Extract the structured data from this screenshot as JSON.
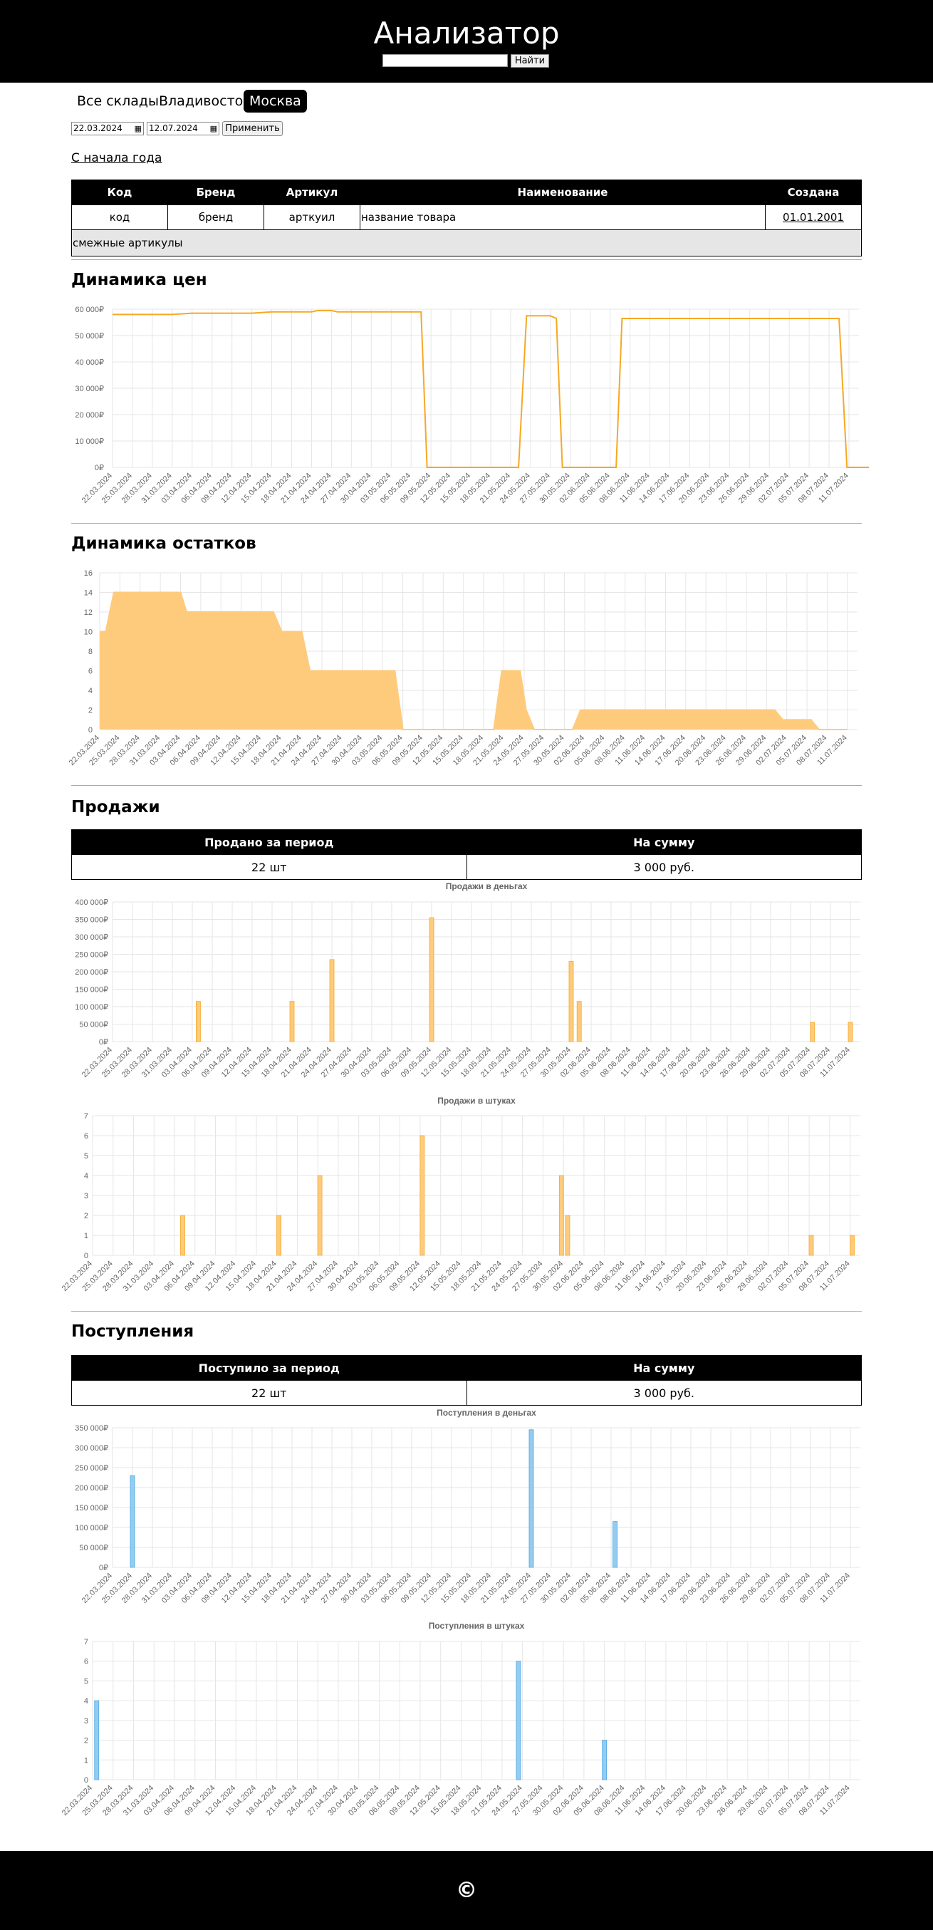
{
  "header": {
    "title": "Анализатор",
    "search_value": "",
    "search_button": "Найти"
  },
  "tabs": [
    "Все склады",
    "Владивосток",
    "Москва"
  ],
  "filters": {
    "date_from": "22.03.2024",
    "date_to": "12.07.2024",
    "apply_label": "Применить"
  },
  "since_link": "С начала года",
  "product": {
    "headers": [
      "Код",
      "Бренд",
      "Артикул",
      "Наименование",
      "Создана"
    ],
    "row": [
      "код",
      "бренд",
      "арткуил",
      "название товара",
      "01.01.2001"
    ],
    "related": "смежные артикулы"
  },
  "sections": {
    "prices": "Динамика цен",
    "stock": "Динамика остатков",
    "sales": "Продажи",
    "supplies": "Поступления"
  },
  "sales_summary": {
    "headers": [
      "Продано за период",
      "На сумму"
    ],
    "values": [
      "22 шт",
      "3 000 руб."
    ]
  },
  "supplies_summary": {
    "headers": [
      "Поступило за период",
      "На сумму"
    ],
    "values": [
      "22 шт",
      "3 000 руб."
    ]
  },
  "footer": {
    "copyright": "©"
  },
  "colors": {
    "orange_line": "#f7a823",
    "orange_fill": "#fecb7c",
    "blue_fill": "#94cbf0",
    "blue_line": "#4ba7e3"
  },
  "chart_data": [
    {
      "id": "price",
      "type": "line",
      "title": "",
      "x": [
        "22.03.2024",
        "25.03.2024",
        "28.03.2024",
        "31.03.2024",
        "03.04.2024",
        "06.04.2024",
        "09.04.2024",
        "12.04.2024",
        "15.04.2024",
        "18.04.2024",
        "21.04.2024",
        "24.04.2024",
        "27.04.2024",
        "30.04.2024",
        "03.05.2024",
        "06.05.2024",
        "09.05.2024",
        "12.05.2024",
        "15.05.2024",
        "18.05.2024",
        "21.05.2024",
        "24.05.2024",
        "27.05.2024",
        "30.05.2024",
        "02.06.2024",
        "05.06.2024",
        "08.06.2024",
        "11.06.2024",
        "14.06.2024",
        "17.06.2024",
        "20.06.2024",
        "23.06.2024",
        "26.06.2024",
        "29.06.2024",
        "02.07.2024",
        "05.07.2024",
        "08.07.2024",
        "11.07.2024"
      ],
      "yticks": [
        "0₽",
        "10 000₽",
        "20 000₽",
        "30 000₽",
        "40 000₽",
        "50 000₽",
        "60 000₽"
      ],
      "ylim": [
        0,
        60000
      ],
      "points": [
        [
          0,
          58000
        ],
        [
          3,
          58000
        ],
        [
          4,
          58500
        ],
        [
          7,
          58500
        ],
        [
          8,
          59000
        ],
        [
          10,
          59000
        ],
        [
          10.3,
          59500
        ],
        [
          11,
          59500
        ],
        [
          11.3,
          59000
        ],
        [
          15.5,
          59000
        ],
        [
          15.8,
          0
        ],
        [
          20.4,
          0
        ],
        [
          20.8,
          57500
        ],
        [
          22,
          57500
        ],
        [
          22.3,
          56500
        ],
        [
          22.6,
          0
        ],
        [
          25.3,
          0
        ],
        [
          25.6,
          56500
        ],
        [
          36.5,
          56500
        ],
        [
          36.9,
          0
        ],
        [
          38,
          0
        ]
      ]
    },
    {
      "id": "stock",
      "type": "area",
      "title": "",
      "x": [
        "22.03.2024",
        "25.03.2024",
        "28.03.2024",
        "31.03.2024",
        "03.04.2024",
        "06.04.2024",
        "09.04.2024",
        "12.04.2024",
        "15.04.2024",
        "18.04.2024",
        "21.04.2024",
        "24.04.2024",
        "27.04.2024",
        "30.04.2024",
        "03.05.2024",
        "06.05.2024",
        "09.05.2024",
        "12.05.2024",
        "15.05.2024",
        "18.05.2024",
        "21.05.2024",
        "24.05.2024",
        "27.05.2024",
        "30.05.2024",
        "02.06.2024",
        "05.06.2024",
        "08.06.2024",
        "11.06.2024",
        "14.06.2024",
        "17.06.2024",
        "20.06.2024",
        "23.06.2024",
        "26.06.2024",
        "29.06.2024",
        "02.07.2024",
        "05.07.2024",
        "08.07.2024",
        "11.07.2024"
      ],
      "yticks": [
        "0",
        "2",
        "4",
        "6",
        "8",
        "10",
        "12",
        "14",
        "16"
      ],
      "ylim": [
        0,
        16
      ],
      "points": [
        [
          0,
          10
        ],
        [
          0.3,
          10
        ],
        [
          0.7,
          14
        ],
        [
          4,
          14
        ],
        [
          4.3,
          12
        ],
        [
          8.6,
          12
        ],
        [
          9,
          10
        ],
        [
          10,
          10
        ],
        [
          10.4,
          6
        ],
        [
          14.6,
          6
        ],
        [
          15,
          0
        ],
        [
          19.5,
          0
        ],
        [
          19.9,
          6
        ],
        [
          20.8,
          6
        ],
        [
          21.1,
          2
        ],
        [
          21.5,
          0
        ],
        [
          23.4,
          0
        ],
        [
          23.8,
          2
        ],
        [
          33.4,
          2
        ],
        [
          33.8,
          1
        ],
        [
          35.2,
          1
        ],
        [
          35.6,
          0
        ],
        [
          37,
          0
        ]
      ]
    },
    {
      "id": "sales_money",
      "type": "bar",
      "title": "Продажи в деньгах",
      "x": [
        "22.03.2024",
        "25.03.2024",
        "28.03.2024",
        "31.03.2024",
        "03.04.2024",
        "06.04.2024",
        "09.04.2024",
        "12.04.2024",
        "15.04.2024",
        "18.04.2024",
        "21.04.2024",
        "24.04.2024",
        "27.04.2024",
        "30.04.2024",
        "03.05.2024",
        "06.05.2024",
        "09.05.2024",
        "12.05.2024",
        "15.05.2024",
        "18.05.2024",
        "21.05.2024",
        "24.05.2024",
        "27.05.2024",
        "30.05.2024",
        "02.06.2024",
        "05.06.2024",
        "08.06.2024",
        "11.06.2024",
        "14.06.2024",
        "17.06.2024",
        "20.06.2024",
        "23.06.2024",
        "26.06.2024",
        "29.06.2024",
        "02.07.2024",
        "05.07.2024",
        "08.07.2024",
        "11.07.2024"
      ],
      "yticks": [
        "0₽",
        "50 000₽",
        "100 000₽",
        "150 000₽",
        "200 000₽",
        "250 000₽",
        "300 000₽",
        "350 000₽",
        "400 000₽"
      ],
      "ylim": [
        0,
        400000
      ],
      "bars": [
        [
          4.3,
          115000
        ],
        [
          9,
          115000
        ],
        [
          11,
          235000
        ],
        [
          16,
          355000
        ],
        [
          23,
          230000
        ],
        [
          23.4,
          115000
        ],
        [
          35.1,
          55000
        ],
        [
          37,
          55000
        ]
      ]
    },
    {
      "id": "sales_count",
      "type": "bar",
      "title": "Продажи в штуках",
      "x": [
        "22.03.2024",
        "25.03.2024",
        "28.03.2024",
        "31.03.2024",
        "03.04.2024",
        "06.04.2024",
        "09.04.2024",
        "12.04.2024",
        "15.04.2024",
        "18.04.2024",
        "21.04.2024",
        "24.04.2024",
        "27.04.2024",
        "30.04.2024",
        "03.05.2024",
        "06.05.2024",
        "09.05.2024",
        "12.05.2024",
        "15.05.2024",
        "18.05.2024",
        "21.05.2024",
        "24.05.2024",
        "27.05.2024",
        "30.05.2024",
        "02.06.2024",
        "05.06.2024",
        "08.06.2024",
        "11.06.2024",
        "14.06.2024",
        "17.06.2024",
        "20.06.2024",
        "23.06.2024",
        "26.06.2024",
        "29.06.2024",
        "02.07.2024",
        "05.07.2024",
        "08.07.2024",
        "11.07.2024"
      ],
      "yticks": [
        "0",
        "1",
        "2",
        "3",
        "4",
        "5",
        "6",
        "7"
      ],
      "ylim": [
        0,
        7
      ],
      "bars": [
        [
          4.4,
          2
        ],
        [
          9.1,
          2
        ],
        [
          11.1,
          4
        ],
        [
          16.1,
          6
        ],
        [
          22.9,
          4
        ],
        [
          23.2,
          2
        ],
        [
          35.1,
          1
        ],
        [
          37.1,
          1
        ]
      ]
    },
    {
      "id": "supplies_money",
      "type": "bar",
      "title": "Поступления в деньгах",
      "x": [
        "22.03.2024",
        "25.03.2024",
        "28.03.2024",
        "31.03.2024",
        "03.04.2024",
        "06.04.2024",
        "09.04.2024",
        "12.04.2024",
        "15.04.2024",
        "18.04.2024",
        "21.04.2024",
        "24.04.2024",
        "27.04.2024",
        "30.04.2024",
        "03.05.2024",
        "06.05.2024",
        "09.05.2024",
        "12.05.2024",
        "15.05.2024",
        "18.05.2024",
        "21.05.2024",
        "24.05.2024",
        "27.05.2024",
        "30.05.2024",
        "02.06.2024",
        "05.06.2024",
        "08.06.2024",
        "11.06.2024",
        "14.06.2024",
        "17.06.2024",
        "20.06.2024",
        "23.06.2024",
        "26.06.2024",
        "29.06.2024",
        "02.07.2024",
        "05.07.2024",
        "08.07.2024",
        "11.07.2024"
      ],
      "yticks": [
        "0₽",
        "50 000₽",
        "100 000₽",
        "150 000₽",
        "200 000₽",
        "250 000₽",
        "300 000₽",
        "350 000₽"
      ],
      "ylim": [
        0,
        350000
      ],
      "bars": [
        [
          1,
          230000
        ],
        [
          21,
          345000
        ],
        [
          25.2,
          115000
        ]
      ]
    },
    {
      "id": "supplies_count",
      "type": "bar",
      "title": "Поступления в штуках",
      "x": [
        "22.03.2024",
        "25.03.2024",
        "28.03.2024",
        "31.03.2024",
        "03.04.2024",
        "06.04.2024",
        "09.04.2024",
        "12.04.2024",
        "15.04.2024",
        "18.04.2024",
        "21.04.2024",
        "24.04.2024",
        "27.04.2024",
        "30.04.2024",
        "03.05.2024",
        "06.05.2024",
        "09.05.2024",
        "12.05.2024",
        "15.05.2024",
        "18.05.2024",
        "21.05.2024",
        "24.05.2024",
        "27.05.2024",
        "30.05.2024",
        "02.06.2024",
        "05.06.2024",
        "08.06.2024",
        "11.06.2024",
        "14.06.2024",
        "17.06.2024",
        "20.06.2024",
        "23.06.2024",
        "26.06.2024",
        "29.06.2024",
        "02.07.2024",
        "05.07.2024",
        "08.07.2024",
        "11.07.2024"
      ],
      "yticks": [
        "0",
        "1",
        "2",
        "3",
        "4",
        "5",
        "6",
        "7"
      ],
      "ylim": [
        0,
        7
      ],
      "bars": [
        [
          0.2,
          4
        ],
        [
          20.8,
          6
        ],
        [
          25,
          2
        ]
      ]
    }
  ]
}
